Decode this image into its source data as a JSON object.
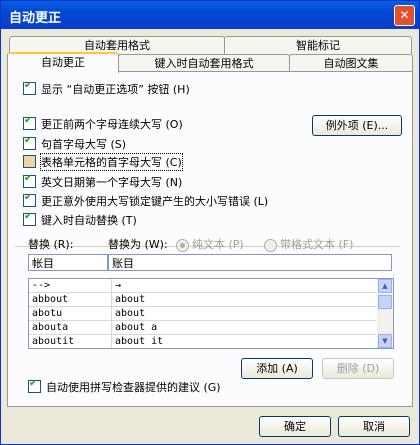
{
  "window": {
    "title": "自动更正",
    "close_symbol": "✕"
  },
  "tabs": {
    "row1": [
      "自动套用格式",
      "智能标记"
    ],
    "row2": [
      "自动更正",
      "键入时自动套用格式",
      "自动图文集"
    ]
  },
  "options": [
    {
      "label": "显示 “自动更正选项” 按钮 (H)",
      "checked": true
    },
    {
      "label": "更正前两个字母连续大写 (O)",
      "checked": true
    },
    {
      "label": "句首字母大写 (S)",
      "checked": true
    },
    {
      "label": "表格单元格的首字母大写 (C)",
      "checked": false
    },
    {
      "label": "英文日期第一个字母大写 (N)",
      "checked": true
    },
    {
      "label": "更正意外使用大写锁定键产生的大小写错误 (L)",
      "checked": true
    },
    {
      "label": "键入时自动替换 (T)",
      "checked": true
    }
  ],
  "exceptions_button": "例外项 (E)...",
  "replace": {
    "replace_label": "替换 (R):",
    "with_label": "替换为 (W):",
    "plain_text": "纯文本 (P)",
    "formatted_text": "带格式文本 (F)",
    "replace_value": "帐目",
    "with_value": "账目"
  },
  "list": [
    {
      "from": "-->",
      "to": "→"
    },
    {
      "from": "abbout",
      "to": "about"
    },
    {
      "from": "abotu",
      "to": "about"
    },
    {
      "from": "abouta",
      "to": "about a"
    },
    {
      "from": "aboutit",
      "to": "about it"
    }
  ],
  "add_button": "添加 (A)",
  "delete_button": "删除 (D)",
  "spellcheck_option": {
    "label": "自动使用拼写检查器提供的建议 (G)",
    "checked": true
  },
  "ok_button": "确定",
  "cancel_button": "取消"
}
